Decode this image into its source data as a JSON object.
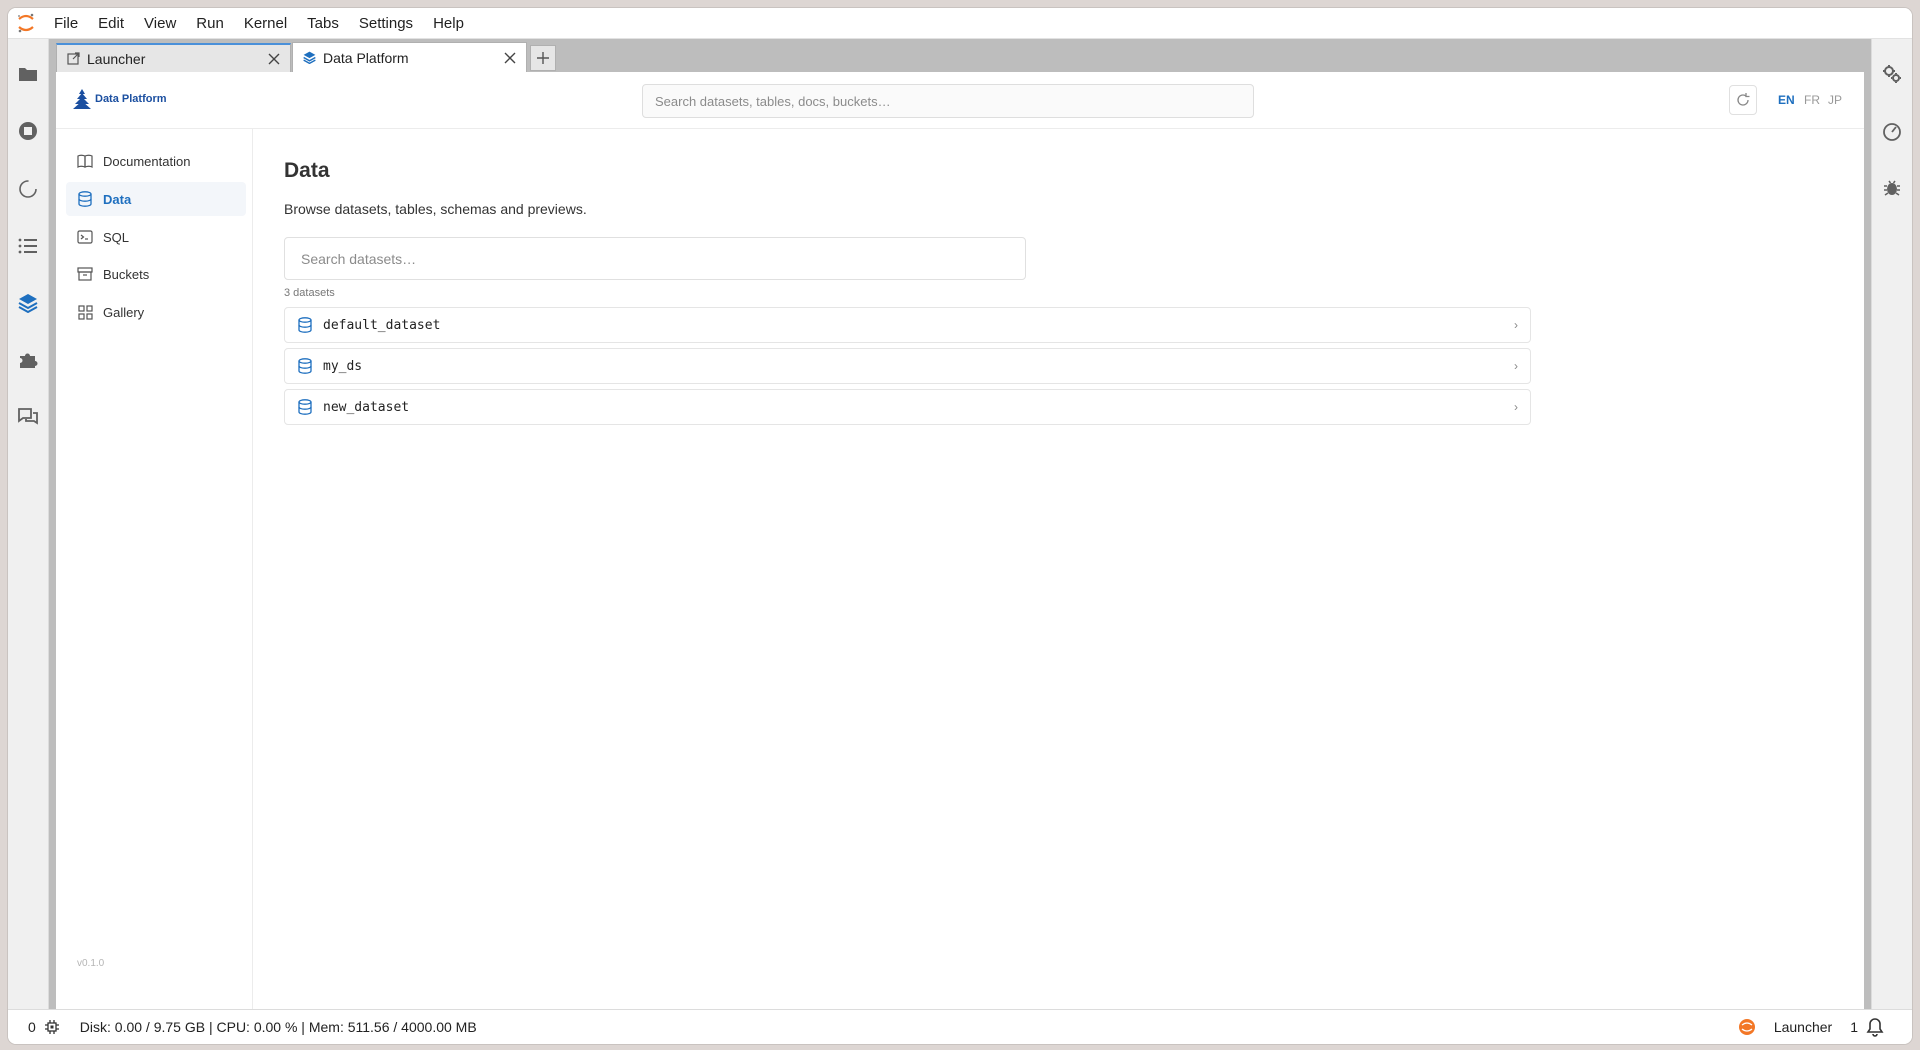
{
  "menubar": {
    "items": [
      "File",
      "Edit",
      "View",
      "Run",
      "Kernel",
      "Tabs",
      "Settings",
      "Help"
    ]
  },
  "tabs": [
    {
      "label": "Launcher",
      "icon": "launcher-icon"
    },
    {
      "label": "Data Platform",
      "icon": "layers-icon"
    }
  ],
  "header": {
    "brand": "Data Platform",
    "search_placeholder": "Search datasets, tables, docs, buckets…",
    "languages": [
      "EN",
      "FR",
      "JP"
    ],
    "active_language": "EN"
  },
  "sidenav": {
    "items": [
      {
        "label": "Documentation",
        "icon": "book-icon"
      },
      {
        "label": "Data",
        "icon": "database-icon"
      },
      {
        "label": "SQL",
        "icon": "terminal-icon"
      },
      {
        "label": "Buckets",
        "icon": "archive-icon"
      },
      {
        "label": "Gallery",
        "icon": "grid-icon"
      }
    ],
    "active": "Data",
    "version": "v0.1.0"
  },
  "content": {
    "title": "Data",
    "description": "Browse datasets, tables, schemas and previews.",
    "search_placeholder": "Search datasets…",
    "count_label": "3 datasets",
    "datasets": [
      "default_dataset",
      "my_ds",
      "new_dataset"
    ]
  },
  "statusbar": {
    "kernel_count": "0",
    "resources": "Disk: 0.00 / 9.75 GB | CPU: 0.00 % | Mem: 511.56 / 4000.00 MB",
    "active_tab": "Launcher",
    "notifications": "1"
  },
  "colors": {
    "accent": "#1e6fbf",
    "brand": "#1b4fa0",
    "jupyter_orange": "#f37726"
  }
}
